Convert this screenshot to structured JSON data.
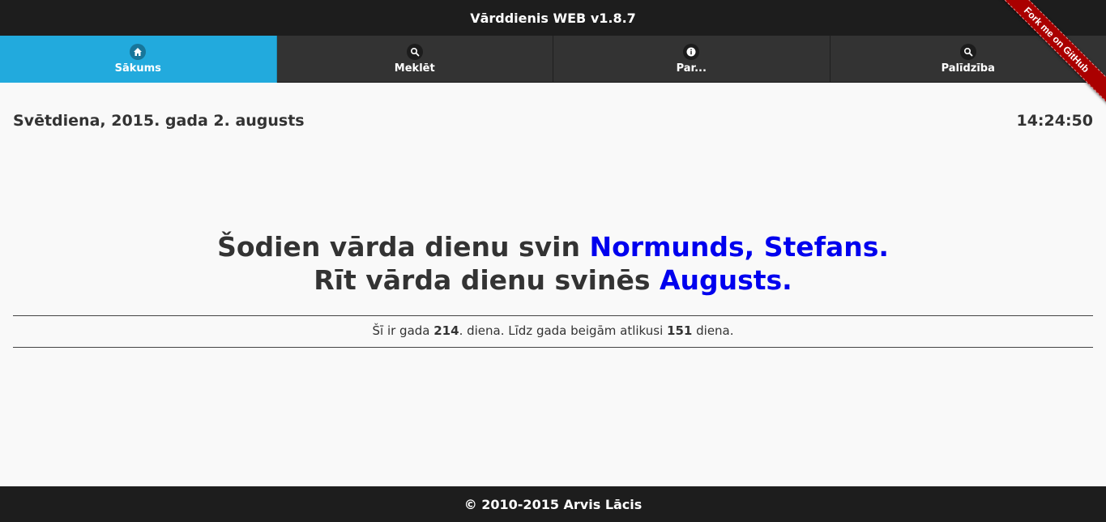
{
  "header": {
    "title": "Vārddienis WEB v1.8.7"
  },
  "ribbon": {
    "label": "Fork me on GitHub"
  },
  "nav": {
    "items": [
      {
        "label": "Sākums",
        "icon": "home-icon",
        "active": true
      },
      {
        "label": "Meklēt",
        "icon": "search-icon",
        "active": false
      },
      {
        "label": "Par...",
        "icon": "info-icon",
        "active": false
      },
      {
        "label": "Palīdzība",
        "icon": "search-icon",
        "active": false
      }
    ]
  },
  "today": {
    "date": "Svētdiena, 2015. gada 2. augusts",
    "time": "14:24:50"
  },
  "names": {
    "today_prefix": "Šodien vārda dienu svin ",
    "today_names": "Normunds, Stefans.",
    "tomorrow_prefix": "Rīt vārda dienu svinēs ",
    "tomorrow_names": "Augusts."
  },
  "stats": {
    "prefix": "Šī ir gada ",
    "day_of_year": "214",
    "middle": ". diena. Līdz gada beigām atlikusi ",
    "days_left": "151",
    "suffix": " diena."
  },
  "footer": {
    "text": "© 2010-2015 Arvis Lācis"
  },
  "colors": {
    "active_tab": "#22aadd",
    "bar_background": "#1d1d1d",
    "name_highlight": "#0000ee",
    "ribbon": "#aa0000"
  }
}
